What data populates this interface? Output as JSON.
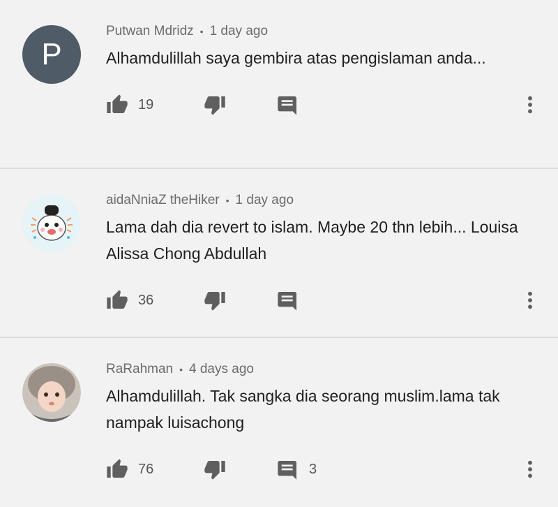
{
  "colors": {
    "background": "#f2f2f2",
    "icon": "#5f5f5f",
    "letter_avatar": "#4f5b66"
  },
  "comments": [
    {
      "author": "Putwan Mdridz",
      "time": "1 day ago",
      "avatar_letter": "P",
      "text": "Alhamdulillah saya gembira atas pengislaman anda...",
      "likes": "19",
      "replies": ""
    },
    {
      "author": "aidaNniaZ theHiker",
      "time": "1 day ago",
      "avatar_letter": "",
      "text": "Lama dah dia revert to islam. Maybe 20 thn lebih... Louisa Alissa Chong Abdullah",
      "likes": "36",
      "replies": ""
    },
    {
      "author": "RaRahman",
      "time": "4 days ago",
      "avatar_letter": "",
      "text": "Alhamdulillah. Tak sangka dia seorang muslim.lama tak nampak luisachong",
      "likes": "76",
      "replies": "3"
    }
  ]
}
